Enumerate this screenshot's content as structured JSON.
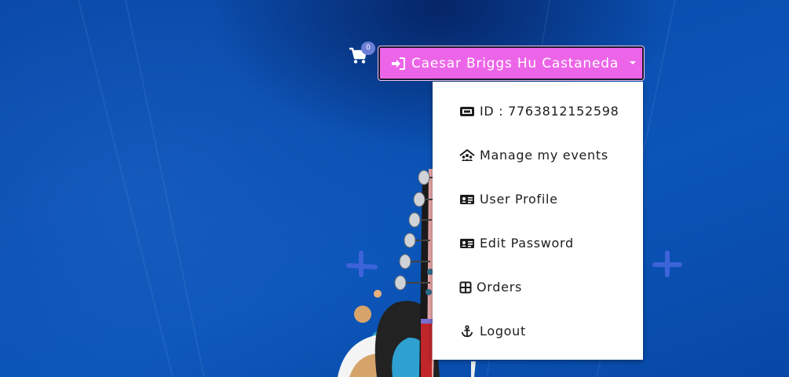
{
  "header": {
    "cart": {
      "icon": "shopping-cart-icon",
      "count": "0"
    },
    "user_button": {
      "icon": "sign-in-icon",
      "name": "Caesar Briggs Hu Castaneda",
      "background": "#ec65e8"
    }
  },
  "dropdown": {
    "items": [
      {
        "label": "ID : 7763812152598",
        "icon": "ticket-icon"
      },
      {
        "label": "Manage my events",
        "icon": "group-house-icon"
      },
      {
        "label": "User Profile",
        "icon": "id-card-icon"
      },
      {
        "label": "Edit Password",
        "icon": "id-card-icon"
      },
      {
        "label": "Orders",
        "icon": "grid-icon"
      },
      {
        "label": "Logout",
        "icon": "anchor-icon"
      }
    ]
  },
  "colors": {
    "background": "#0b4fb0",
    "accent": "#ec65e8",
    "badge": "#6b7fd6"
  }
}
